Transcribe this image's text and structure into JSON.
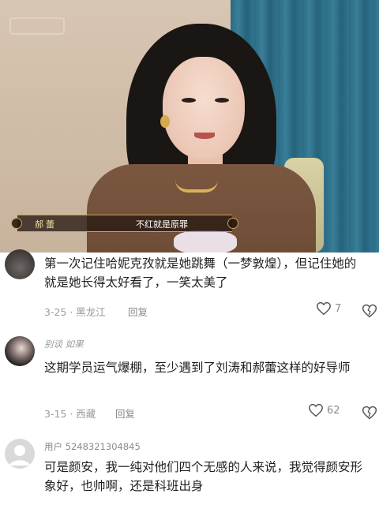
{
  "video": {
    "subtitle_name": "郝蕾",
    "subtitle_caption": "不红就是原罪"
  },
  "comments": [
    {
      "username": "",
      "text": "第一次记住哈妮克孜就是她跳舞（一梦敦煌），但记住她的就是她长得太好看了，一笑太美了",
      "date": "3-25 · 黑龙江",
      "reply_label": "回复",
      "likes": "7"
    },
    {
      "username": "别谈 如果",
      "text": "这期学员运气爆棚，至少遇到了刘涛和郝蕾这样的好导师",
      "date": "3-15 · 西藏",
      "reply_label": "回复",
      "likes": "62"
    },
    {
      "username": "用户 5248321304845",
      "text": "可是颜安，我一纯对他们四个无感的人来说，我觉得颜安形象好，也帅啊，还是科班出身"
    }
  ],
  "icons": {
    "like": "heart-outline-icon",
    "dislike": "broken-heart-icon",
    "default_avatar": "default-user-avatar-icon"
  },
  "colors": {
    "meta_text": "#9a9a9a",
    "body_text": "#1f1f1f",
    "subtitle_gold": "#c6a15a"
  }
}
